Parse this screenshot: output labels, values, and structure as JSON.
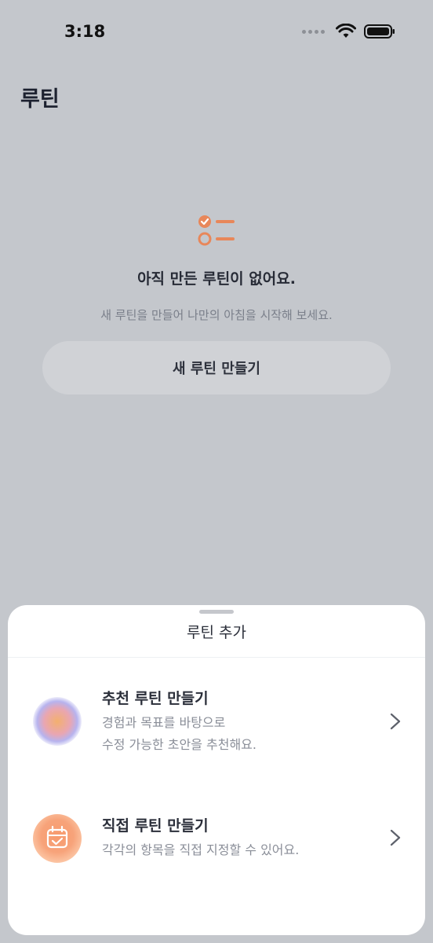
{
  "status_bar": {
    "time": "3:18"
  },
  "header": {
    "title": "루틴"
  },
  "empty_state": {
    "title": "아직 만든 루틴이 없어요.",
    "subtitle": "새 루틴을 만들어 나만의 아침을 시작해 보세요.",
    "button_label": "새 루틴 만들기",
    "icon": "checklist-icon"
  },
  "sheet": {
    "title": "루틴 추가",
    "options": [
      {
        "title": "추천 루틴 만들기",
        "desc_line1": "경험과 목표를 바탕으로",
        "desc_line2": "수정 가능한 초안을 추천해요.",
        "icon": "sparkle-orb-icon"
      },
      {
        "title": "직접 루틴 만들기",
        "desc_line1": "각각의 항목을 직접 지정할 수 있어요.",
        "icon": "calendar-check-icon"
      }
    ]
  },
  "colors": {
    "accent": "#e8875a",
    "backdrop": "#c4c7cc",
    "sheet": "#ffffff"
  }
}
